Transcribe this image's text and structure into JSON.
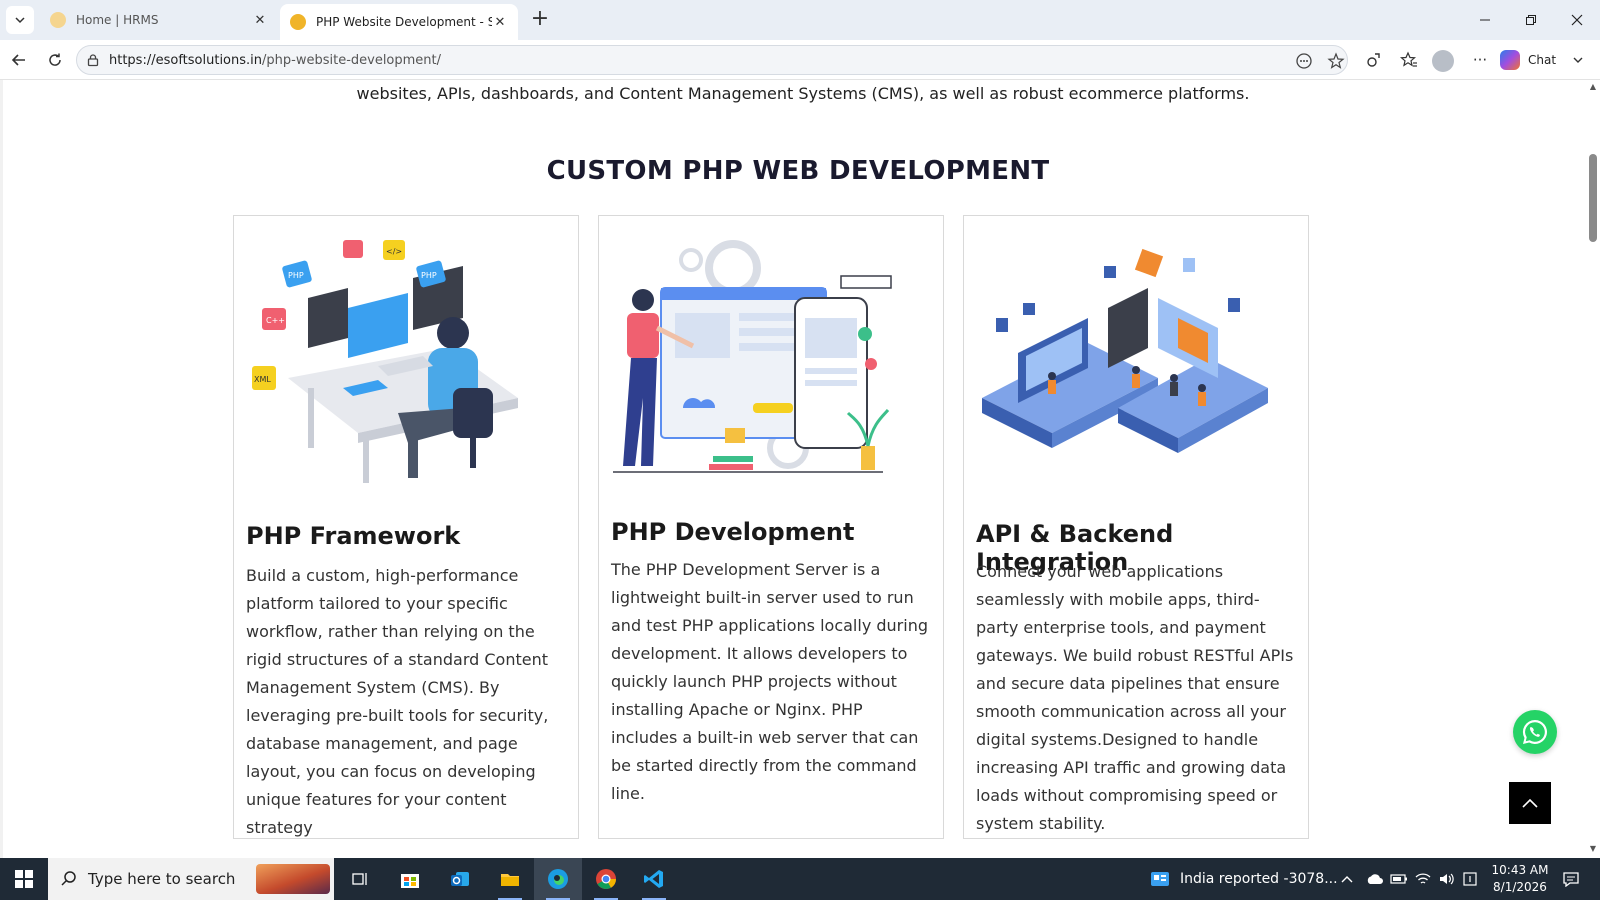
{
  "browser": {
    "tabs": [
      {
        "title": "Home | HRMS",
        "active": false
      },
      {
        "title": "PHP Website Development - Softw",
        "active": true
      }
    ],
    "address": {
      "host": "https://esoftsolutions.in",
      "path": "/php-website-development/"
    },
    "chat_label": "Chat"
  },
  "page": {
    "intro_text": "websites, APIs, dashboards, and Content Management Systems (CMS), as well as robust ecommerce platforms.",
    "section_title": "CUSTOM PHP WEB DEVELOPMENT",
    "cards": [
      {
        "title": "PHP Framework",
        "body": "Build a custom, high-performance platform tailored to your specific workflow, rather than relying on the rigid structures of a standard Content Management System (CMS). By leveraging pre-built tools for security, database management, and page layout, you can focus on developing unique features for your content strategy"
      },
      {
        "title": "PHP Development",
        "body": "The PHP Development Server is a lightweight built-in server used to run and test PHP applications locally during development. It allows developers to quickly launch PHP projects without installing Apache or Nginx. PHP includes a built-in web server that can be started directly from the command line."
      },
      {
        "title": "API & Backend Integration",
        "body": "Connect your web applications seamlessly with mobile apps, third-party enterprise tools, and payment gateways. We build robust RESTful APIs and secure data pipelines that ensure smooth communication across all your digital systems.Designed to handle increasing API traffic and growing data loads without compromising speed or system stability."
      }
    ],
    "illustration_tags": [
      "PHP",
      "PHP",
      "C++",
      "XML",
      "</>"
    ]
  },
  "taskbar": {
    "search_placeholder": "Type here to search",
    "news_text": "India reported -3078...",
    "time": "10:43 AM",
    "date": "8/1/2026"
  },
  "colors": {
    "accent_blue": "#3a7bd5",
    "whatsapp_green": "#25d366",
    "taskbar_bg": "#1f2a36"
  }
}
